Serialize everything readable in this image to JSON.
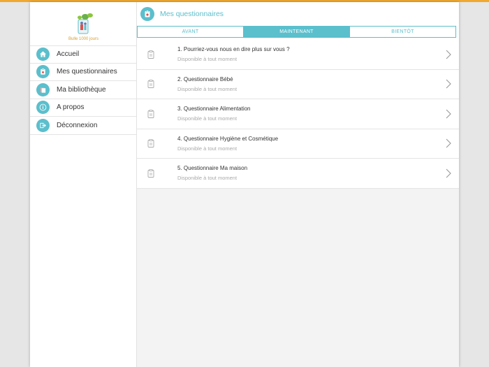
{
  "brand": {
    "logo_text": "Bulle 1000 jours",
    "accent_color": "#5bbfcc",
    "top_bar_color": "#f0a830",
    "logo_text_color": "#d8a030"
  },
  "sidebar": {
    "items": [
      {
        "label": "Accueil",
        "icon": "home-icon"
      },
      {
        "label": "Mes questionnaires",
        "icon": "questionnaire-icon"
      },
      {
        "label": "Ma bibliothèque",
        "icon": "library-icon"
      },
      {
        "label": "A propos",
        "icon": "info-icon"
      },
      {
        "label": "Déconnexion",
        "icon": "logout-icon"
      }
    ]
  },
  "header": {
    "title": "Mes questionnaires",
    "icon": "questionnaire-icon"
  },
  "tabs": [
    {
      "label": "AVANT",
      "active": false
    },
    {
      "label": "MAINTENANT",
      "active": true
    },
    {
      "label": "BIENTÔT",
      "active": false
    }
  ],
  "questionnaires": [
    {
      "title": "1. Pourriez-vous nous en dire plus sur vous ?",
      "status": "Disponible à tout moment"
    },
    {
      "title": "2. Questionnaire Bébé",
      "status": "Disponible à tout moment"
    },
    {
      "title": "3. Questionnaire Alimentation",
      "status": "Disponible à tout moment"
    },
    {
      "title": "4. Questionnaire Hygiène et Cosmétique",
      "status": "Disponible à tout moment"
    },
    {
      "title": "5. Questionnaire Ma maison",
      "status": "Disponible à tout moment"
    }
  ]
}
